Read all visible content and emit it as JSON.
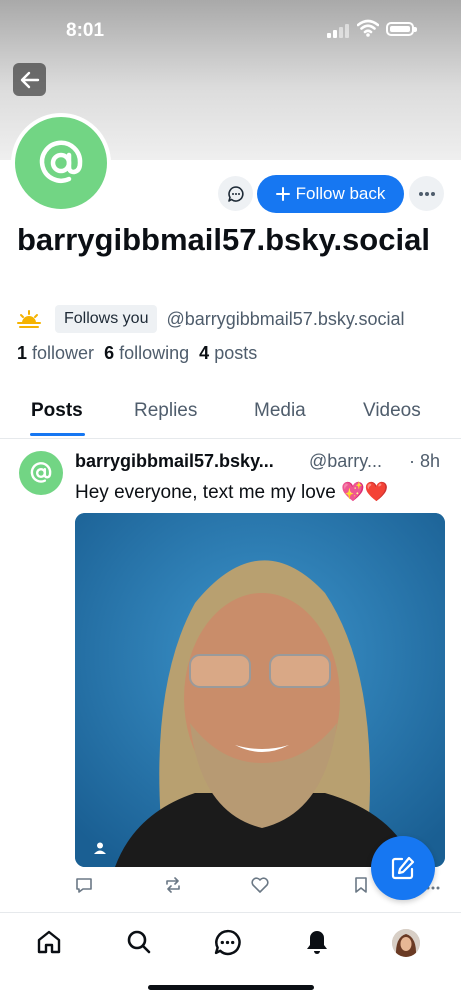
{
  "status_bar": {
    "time": "8:01"
  },
  "profile": {
    "display_handle": "barrygibbmail57.bsky.social",
    "follows_you_label": "Follows you",
    "handle": "@barrygibbmail57.bsky.social",
    "follow_button_label": "Follow back",
    "followers_count": "1",
    "followers_label": "follower",
    "following_count": "6",
    "following_label": "following",
    "posts_count": "4",
    "posts_label": "posts"
  },
  "tabs": [
    {
      "label": "Posts",
      "active": true
    },
    {
      "label": "Replies",
      "active": false
    },
    {
      "label": "Media",
      "active": false
    },
    {
      "label": "Videos",
      "active": false
    }
  ],
  "post": {
    "author_name": "barrygibbmail57.bsky...",
    "author_handle": "@barry...",
    "time": "· 8h",
    "text": "Hey everyone, text me my love 💖❤️"
  },
  "icons": {
    "back": "arrow-left-icon",
    "message": "chat-bubble-icon",
    "more": "ellipsis-icon",
    "compose": "compose-icon",
    "nav": [
      "home-icon",
      "search-icon",
      "chat-icon",
      "bell-icon",
      "profile-avatar"
    ]
  },
  "colors": {
    "accent": "#1677f2",
    "avatar_green": "#72d584"
  }
}
